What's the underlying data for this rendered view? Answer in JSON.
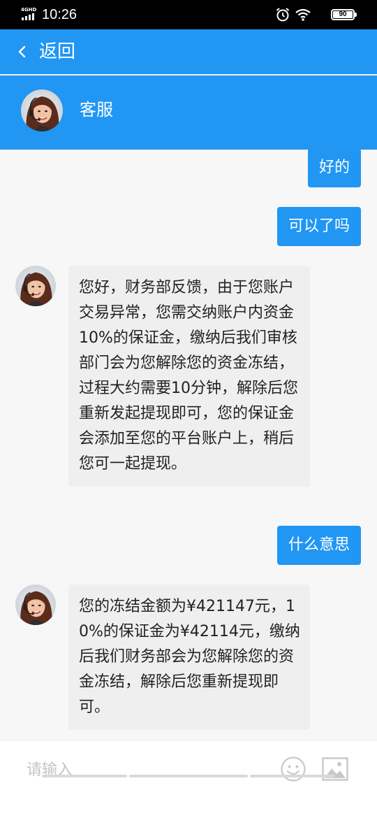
{
  "status_bar": {
    "network_label": "4GHD",
    "time": "10:26",
    "battery": "90",
    "icons": [
      "signal-icon",
      "alarm-icon",
      "wifi-icon",
      "battery-icon"
    ]
  },
  "app_bar": {
    "back_label": "返回",
    "back_icon": "chevron-left-icon",
    "color": "#2196f3"
  },
  "agent": {
    "name": "客服",
    "avatar_icon": "agent-avatar"
  },
  "messages": [
    {
      "side": "out",
      "text": "好的"
    },
    {
      "side": "out",
      "text": "可以了吗"
    },
    {
      "side": "in",
      "text": "您好，财务部反馈，由于您账户交易异常，您需交纳账户内资金10%的保证金，缴纳后我们审核部门会为您解除您的资金冻结，过程大约需要10分钟，解除后您重新发起提现即可，您的保证金会添加至您的平台账户上，稍后您可一起提现。"
    },
    {
      "side": "out",
      "text": "什么意思"
    },
    {
      "side": "in",
      "text": "您的冻结金额为¥421147元，10%的保证金为¥42114元，缴纳后我们财务部会为您解除您的资金冻结，解除后您重新提现即可。"
    }
  ],
  "input_bar": {
    "placeholder": "请输入",
    "value": "",
    "icons": [
      "emoji-icon",
      "image-icon"
    ]
  },
  "colors": {
    "primary": "#2196f3",
    "incoming_bubble": "#efefef",
    "background": "#f7f7f7"
  }
}
